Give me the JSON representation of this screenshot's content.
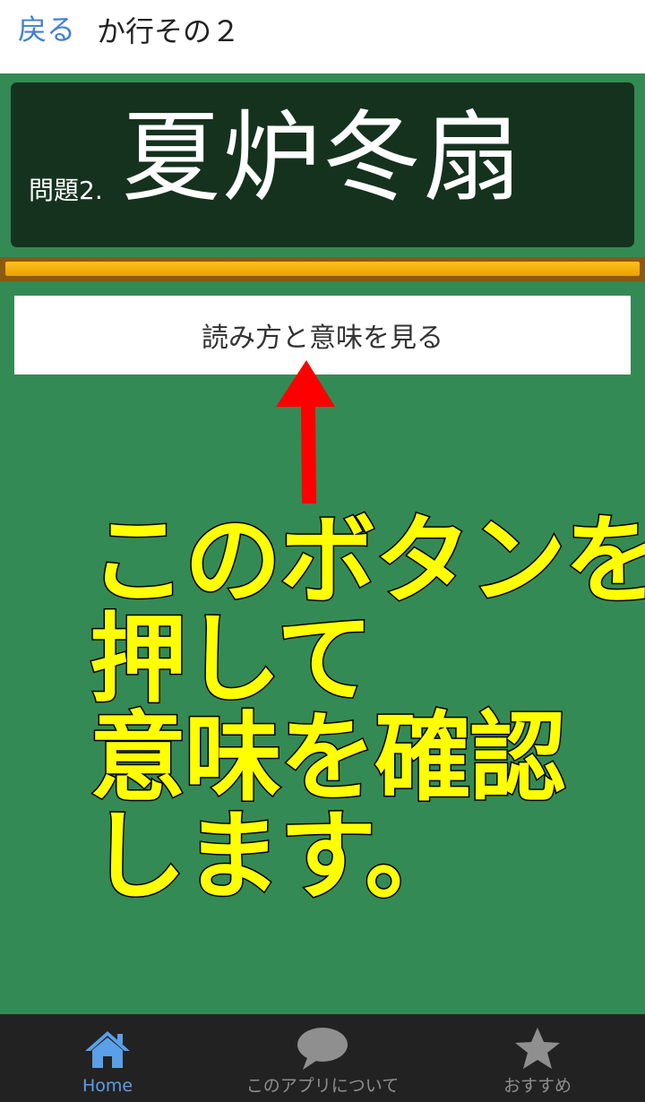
{
  "header": {
    "back_label": "戻る",
    "title": "か行その２"
  },
  "board": {
    "question_label": "問題2.",
    "question_text": "夏炉冬扇"
  },
  "reveal_button": {
    "label": "読み方と意味を見る"
  },
  "annotation": {
    "lines": [
      "このボタンを",
      "押して",
      "意味を確認",
      "します。"
    ],
    "color": "#ffff00",
    "arrow_color": "#ff0000"
  },
  "nav": {
    "items": [
      {
        "label": "Home",
        "icon": "home-icon",
        "active": true
      },
      {
        "label": "このアプリについて",
        "icon": "speech-bubble-icon",
        "active": false
      },
      {
        "label": "おすすめ",
        "icon": "star-icon",
        "active": false
      }
    ]
  },
  "colors": {
    "background": "#348a54",
    "board": "#15321e",
    "tray": "#f0a800",
    "link": "#3f7fd6",
    "nav_active": "#5aa0e8",
    "nav_inactive": "#8f8f8f"
  }
}
